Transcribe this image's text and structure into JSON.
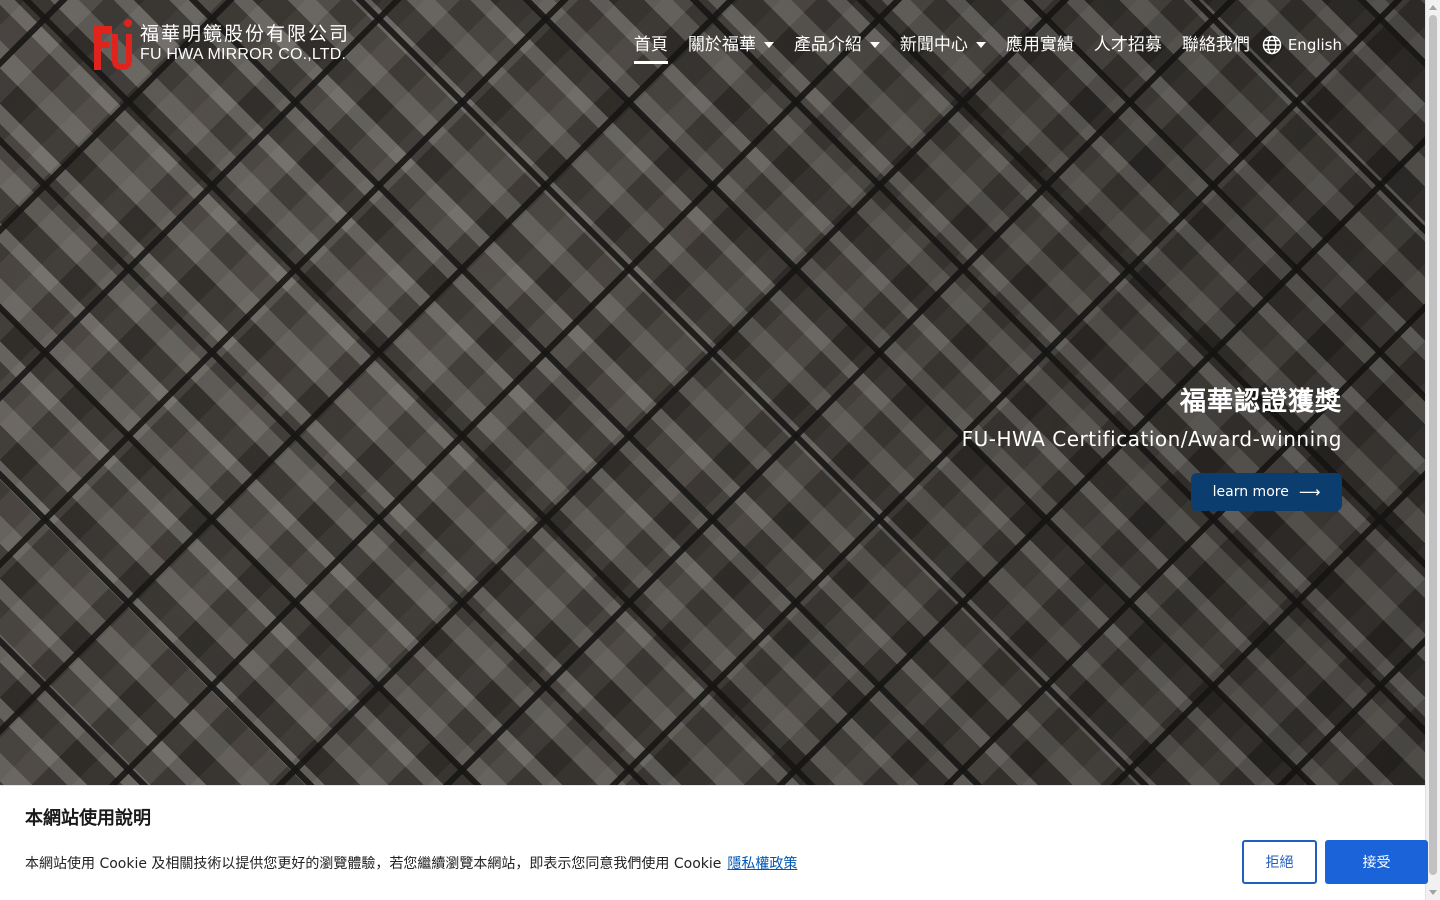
{
  "header": {
    "logo": {
      "mark": "FU",
      "name_cn": "福華明鏡股份有限公司",
      "name_en": "FU HWA MIRROR CO.,LTD."
    },
    "nav": [
      {
        "label": "首頁",
        "active": true,
        "dropdown": false
      },
      {
        "label": "關於福華",
        "active": false,
        "dropdown": true
      },
      {
        "label": "產品介紹",
        "active": false,
        "dropdown": true
      },
      {
        "label": "新聞中心",
        "active": false,
        "dropdown": true
      },
      {
        "label": "應用實績",
        "active": false,
        "dropdown": false
      },
      {
        "label": "人才招募",
        "active": false,
        "dropdown": false
      },
      {
        "label": "聯絡我們",
        "active": false,
        "dropdown": false
      }
    ],
    "language": {
      "label": "English",
      "icon": "globe-icon"
    }
  },
  "hero": {
    "title": "福華認證獲獎",
    "subtitle": "FU-HWA Certification/Award-winning",
    "button_label": "learn more",
    "button_icon": "arrow-right-icon"
  },
  "cookie": {
    "title": "本網站使用說明",
    "text": "本網站使用 Cookie 及相關技術以提供您更好的瀏覽體驗，若您繼續瀏覽本網站，即表示您同意我們使用 Cookie",
    "link": "隱私權政策",
    "decline": "拒絕",
    "accept": "接受"
  },
  "colors": {
    "button_primary": "#0b3d6e",
    "accept_button": "#1a63d8",
    "decline_border": "#1f5fbf",
    "logo_red": "#e0231c"
  }
}
